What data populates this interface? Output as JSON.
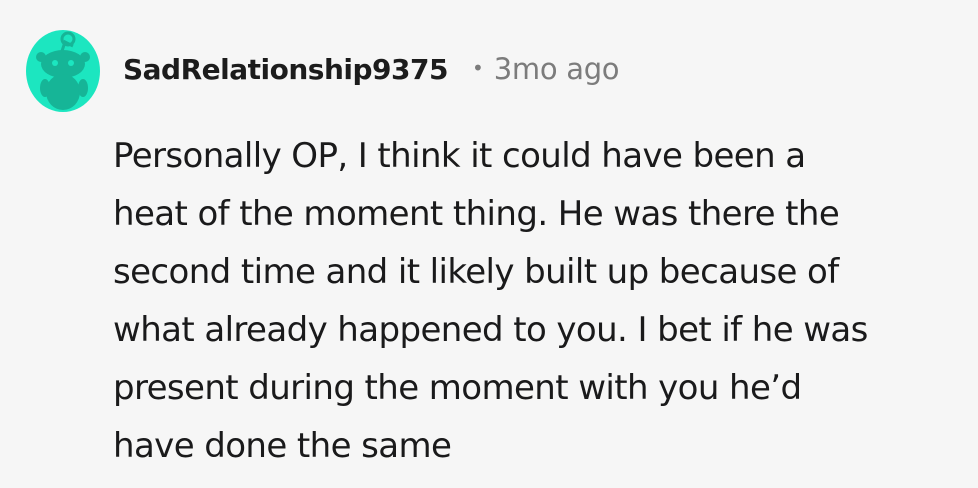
{
  "comment": {
    "avatar_icon": "snoo-avatar-icon",
    "avatar_color": "#1ce6c0",
    "username": "SadRelationship9375",
    "separator": "•",
    "timestamp": "3mo ago",
    "body_lines": [
      "Personally OP, I think it could have been a",
      "heat of the moment thing. He was there the",
      "second time and it likely built up because of",
      "what already happened to you. I bet if he was",
      "present during the moment with you he’d",
      "have done the same"
    ]
  }
}
